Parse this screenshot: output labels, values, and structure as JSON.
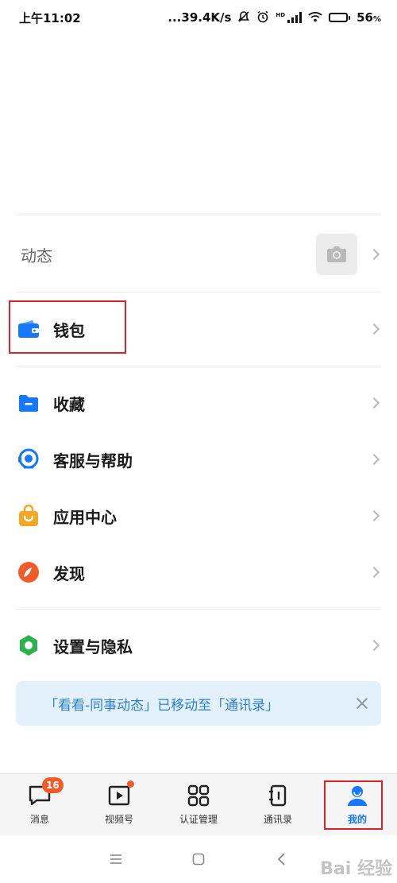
{
  "status_bar": {
    "time": "上午11:02",
    "network_speed": "...39.4K/s",
    "hd_label": "HD",
    "battery_percent": "56",
    "battery_unit": "%",
    "battery_level": 0.56
  },
  "moments": {
    "label": "动态",
    "camera_icon": "camera-icon"
  },
  "wallet": {
    "label": "钱包",
    "icon": "wallet-icon",
    "color": "#1677ff"
  },
  "menu": [
    {
      "label": "收藏",
      "icon": "folder-icon",
      "color": "#1677ff"
    },
    {
      "label": "客服与帮助",
      "icon": "headset-icon",
      "color": "#1677ff"
    },
    {
      "label": "应用中心",
      "icon": "bag-icon",
      "color": "#f5a623"
    },
    {
      "label": "发现",
      "icon": "compass-icon",
      "color": "#f15b2a"
    }
  ],
  "settings": {
    "label": "设置与隐私",
    "icon": "gear-icon",
    "color": "#2bb24c"
  },
  "notice": {
    "text": "「看看-同事动态」已移动至「通讯录」"
  },
  "tabs": [
    {
      "label": "消息",
      "icon": "chat-icon",
      "badge": "16"
    },
    {
      "label": "视频号",
      "icon": "video-icon"
    },
    {
      "label": "认证管理",
      "icon": "grid-icon"
    },
    {
      "label": "通讯录",
      "icon": "contacts-icon"
    },
    {
      "label": "我的",
      "icon": "user-icon",
      "active": true
    }
  ],
  "colors": {
    "accent": "#1677ff",
    "highlight": "#d8232a",
    "badge": "#f15b2a"
  },
  "watermark": "Bai 经验"
}
